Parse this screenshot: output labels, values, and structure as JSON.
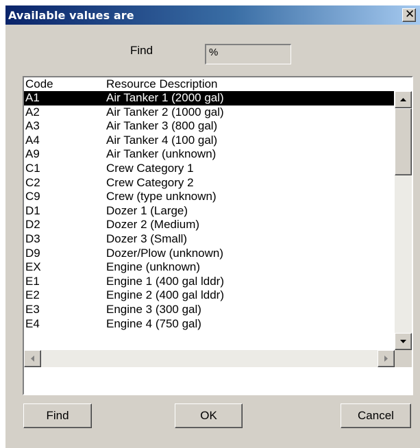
{
  "window": {
    "title": "Available values are",
    "close_icon": "close-icon"
  },
  "search": {
    "label": "Find",
    "value": "%"
  },
  "list": {
    "columns": [
      "Code",
      "Resource Description"
    ],
    "selected_index": 0,
    "rows": [
      {
        "code": "A1",
        "desc": "Air Tanker 1 (2000 gal)"
      },
      {
        "code": "A2",
        "desc": "Air Tanker 2 (1000 gal)"
      },
      {
        "code": "A3",
        "desc": "Air Tanker 3 (800 gal)"
      },
      {
        "code": "A4",
        "desc": "Air Tanker 4 (100 gal)"
      },
      {
        "code": "A9",
        "desc": "Air Tanker (unknown)"
      },
      {
        "code": "C1",
        "desc": "Crew Category 1"
      },
      {
        "code": "C2",
        "desc": "Crew Category 2"
      },
      {
        "code": "C9",
        "desc": "Crew (type unknown)"
      },
      {
        "code": "D1",
        "desc": "Dozer 1 (Large)"
      },
      {
        "code": "D2",
        "desc": "Dozer 2 (Medium)"
      },
      {
        "code": "D3",
        "desc": "Dozer 3 (Small)"
      },
      {
        "code": "D9",
        "desc": "Dozer/Plow (unknown)"
      },
      {
        "code": "EX",
        "desc": "Engine (unknown)"
      },
      {
        "code": "E1",
        "desc": "Engine 1 (400 gal lddr)"
      },
      {
        "code": "E2",
        "desc": "Engine 2 (400 gal lddr)"
      },
      {
        "code": "E3",
        "desc": "Engine 3 (300 gal)"
      },
      {
        "code": "E4",
        "desc": "Engine 4 (750 gal)"
      }
    ]
  },
  "buttons": {
    "find": "Find",
    "ok": "OK",
    "cancel": "Cancel"
  },
  "colors": {
    "title_bar": "#0a246a",
    "dialog_bg": "#d4d0c8",
    "selection": "#000000"
  }
}
